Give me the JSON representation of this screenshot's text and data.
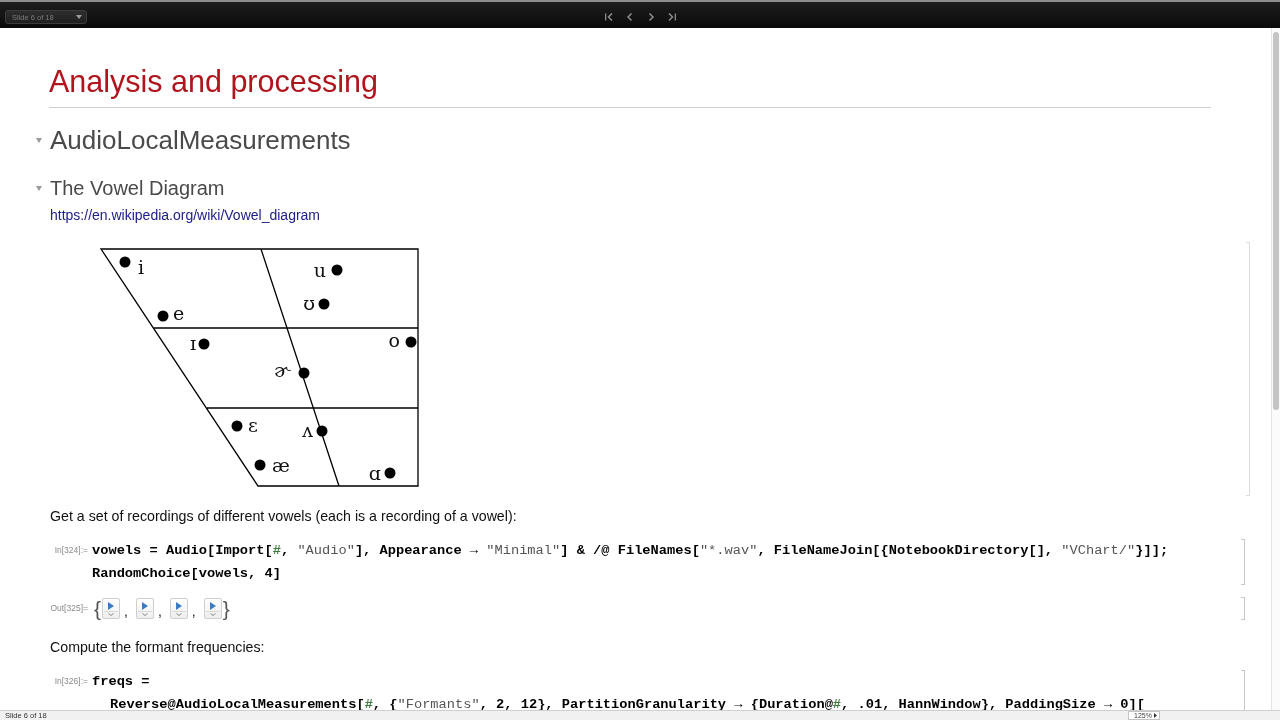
{
  "toolbar": {
    "slide_menu": "Slide 6 of 18",
    "nav_buttons": [
      {
        "kind": "first"
      },
      {
        "kind": "previous"
      },
      {
        "kind": "next"
      },
      {
        "kind": "last"
      }
    ]
  },
  "slide": {
    "title": "Analysis and processing",
    "section": {
      "title": "AudioLocalMeasurements",
      "expanded": true,
      "subsection": {
        "title": "The Vowel Diagram",
        "expanded": true,
        "link": "https://en.wikipedia.org/wiki/Vowel_diagram",
        "vowel_diagram": {
          "vowels": [
            {
              "symbol": "i"
            },
            {
              "symbol": "u"
            },
            {
              "symbol": "ʊ"
            },
            {
              "symbol": "e"
            },
            {
              "symbol": "ɪ"
            },
            {
              "symbol": "o"
            },
            {
              "symbol": "ɚ"
            },
            {
              "symbol": "ɛ"
            },
            {
              "symbol": "ʌ"
            },
            {
              "symbol": "æ"
            },
            {
              "symbol": "ɑ"
            }
          ]
        },
        "cells": [
          {
            "kind": "text",
            "text": "Get a set of recordings of different vowels (each is a recording of a vowel):"
          },
          {
            "kind": "input",
            "label": "In[324]:=",
            "lines": [
              {
                "indented": false,
                "tokens": [
                  {
                    "kind": "plain",
                    "text": "vowels = Audio[Import["
                  },
                  {
                    "kind": "slot",
                    "text": "#"
                  },
                  {
                    "kind": "plain",
                    "text": ", "
                  },
                  {
                    "kind": "string",
                    "text": "\"Audio\""
                  },
                  {
                    "kind": "plain",
                    "text": "], Appearance → "
                  },
                  {
                    "kind": "string",
                    "text": "\"Minimal\""
                  },
                  {
                    "kind": "plain",
                    "text": "] & /@ FileNames["
                  },
                  {
                    "kind": "string",
                    "text": "\"*.wav\""
                  },
                  {
                    "kind": "plain",
                    "text": ", FileNameJoin[{NotebookDirectory[], "
                  },
                  {
                    "kind": "string",
                    "text": "\"VChart/\""
                  },
                  {
                    "kind": "plain",
                    "text": "}]];"
                  }
                ]
              },
              {
                "indented": false,
                "tokens": [
                  {
                    "kind": "plain",
                    "text": "RandomChoice[vowels, 4]"
                  }
                ]
              }
            ]
          },
          {
            "kind": "output",
            "label": "Out[325]=",
            "open": "{",
            "close": "}",
            "items": [
              {
                "kind": "audio",
                "separator": ","
              },
              {
                "kind": "audio",
                "separator": ","
              },
              {
                "kind": "audio",
                "separator": ","
              },
              {
                "kind": "audio"
              }
            ]
          },
          {
            "kind": "text",
            "text": "Compute the formant frequencies:"
          },
          {
            "kind": "input",
            "label": "In[326]:=",
            "lines": [
              {
                "indented": false,
                "tokens": [
                  {
                    "kind": "plain",
                    "text": "freqs ="
                  }
                ]
              },
              {
                "indented": true,
                "tokens": [
                  {
                    "kind": "plain",
                    "text": "Reverse@AudioLocalMeasurements["
                  },
                  {
                    "kind": "slot",
                    "text": "#"
                  },
                  {
                    "kind": "plain",
                    "text": ", {"
                  },
                  {
                    "kind": "string",
                    "text": "\"Formants\""
                  },
                  {
                    "kind": "plain",
                    "text": ", 2, 12}, PartitionGranularity → {Duration@"
                  },
                  {
                    "kind": "slot",
                    "text": "#"
                  },
                  {
                    "kind": "plain",
                    "text": ", .01, HannWindow}, PaddingSize → 0]["
                  }
                ]
              }
            ]
          }
        ]
      }
    }
  },
  "status_bar": {
    "slide_label": "Slide 6 of 18",
    "zoom": "125%"
  }
}
